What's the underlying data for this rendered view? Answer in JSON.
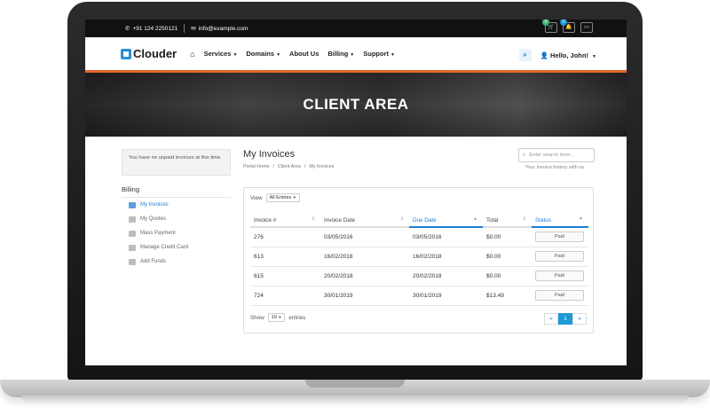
{
  "topbar": {
    "phone": "+91 124 2250121",
    "email": "info@example.com",
    "cart_count": "0",
    "notif_count": "0"
  },
  "navbar": {
    "logo_text": "Clouder",
    "links": [
      "Services",
      "Domains",
      "About Us",
      "Billing",
      "Support"
    ],
    "user_greeting": "Hello, John!"
  },
  "hero": {
    "title": "CLIENT AREA"
  },
  "sidebar": {
    "notice": "You have no unpaid invoices at this time.",
    "heading": "Billing",
    "items": [
      {
        "label": "My Invoices",
        "active": true
      },
      {
        "label": "My Quotes",
        "active": false
      },
      {
        "label": "Mass Payment",
        "active": false
      },
      {
        "label": "Manage Credit Card",
        "active": false
      },
      {
        "label": "Add Funds",
        "active": false
      }
    ]
  },
  "main": {
    "title": "My Invoices",
    "breadcrumb": [
      "Portal Home",
      "/",
      "Client Area",
      "/",
      "My Invoices"
    ],
    "search_placeholder": "Enter search term...",
    "search_subtitle": "Your invoice history with us",
    "view_label": "View",
    "view_value": "All Entries",
    "columns": [
      "Invoice #",
      "Invoice Date",
      "Due Date",
      "Total",
      "Status"
    ],
    "rows": [
      {
        "invoice": "276",
        "invoice_date": "03/05/2016",
        "due_date": "03/05/2016",
        "total": "$0.00",
        "status": "Paid"
      },
      {
        "invoice": "613",
        "invoice_date": "16/02/2018",
        "due_date": "16/02/2018",
        "total": "$0.00",
        "status": "Paid"
      },
      {
        "invoice": "615",
        "invoice_date": "20/02/2018",
        "due_date": "20/02/2018",
        "total": "$0.00",
        "status": "Paid"
      },
      {
        "invoice": "724",
        "invoice_date": "30/01/2019",
        "due_date": "30/01/2019",
        "total": "$13.49",
        "status": "Paid"
      }
    ],
    "show_label": "Show",
    "show_value": "10",
    "entries_label": "entries",
    "pager": {
      "prev": "«",
      "current": "1",
      "next": "»"
    }
  },
  "colors": {
    "accent": "#e2662b",
    "link": "#1c7fd6",
    "pager_active": "#1c9ad6"
  }
}
